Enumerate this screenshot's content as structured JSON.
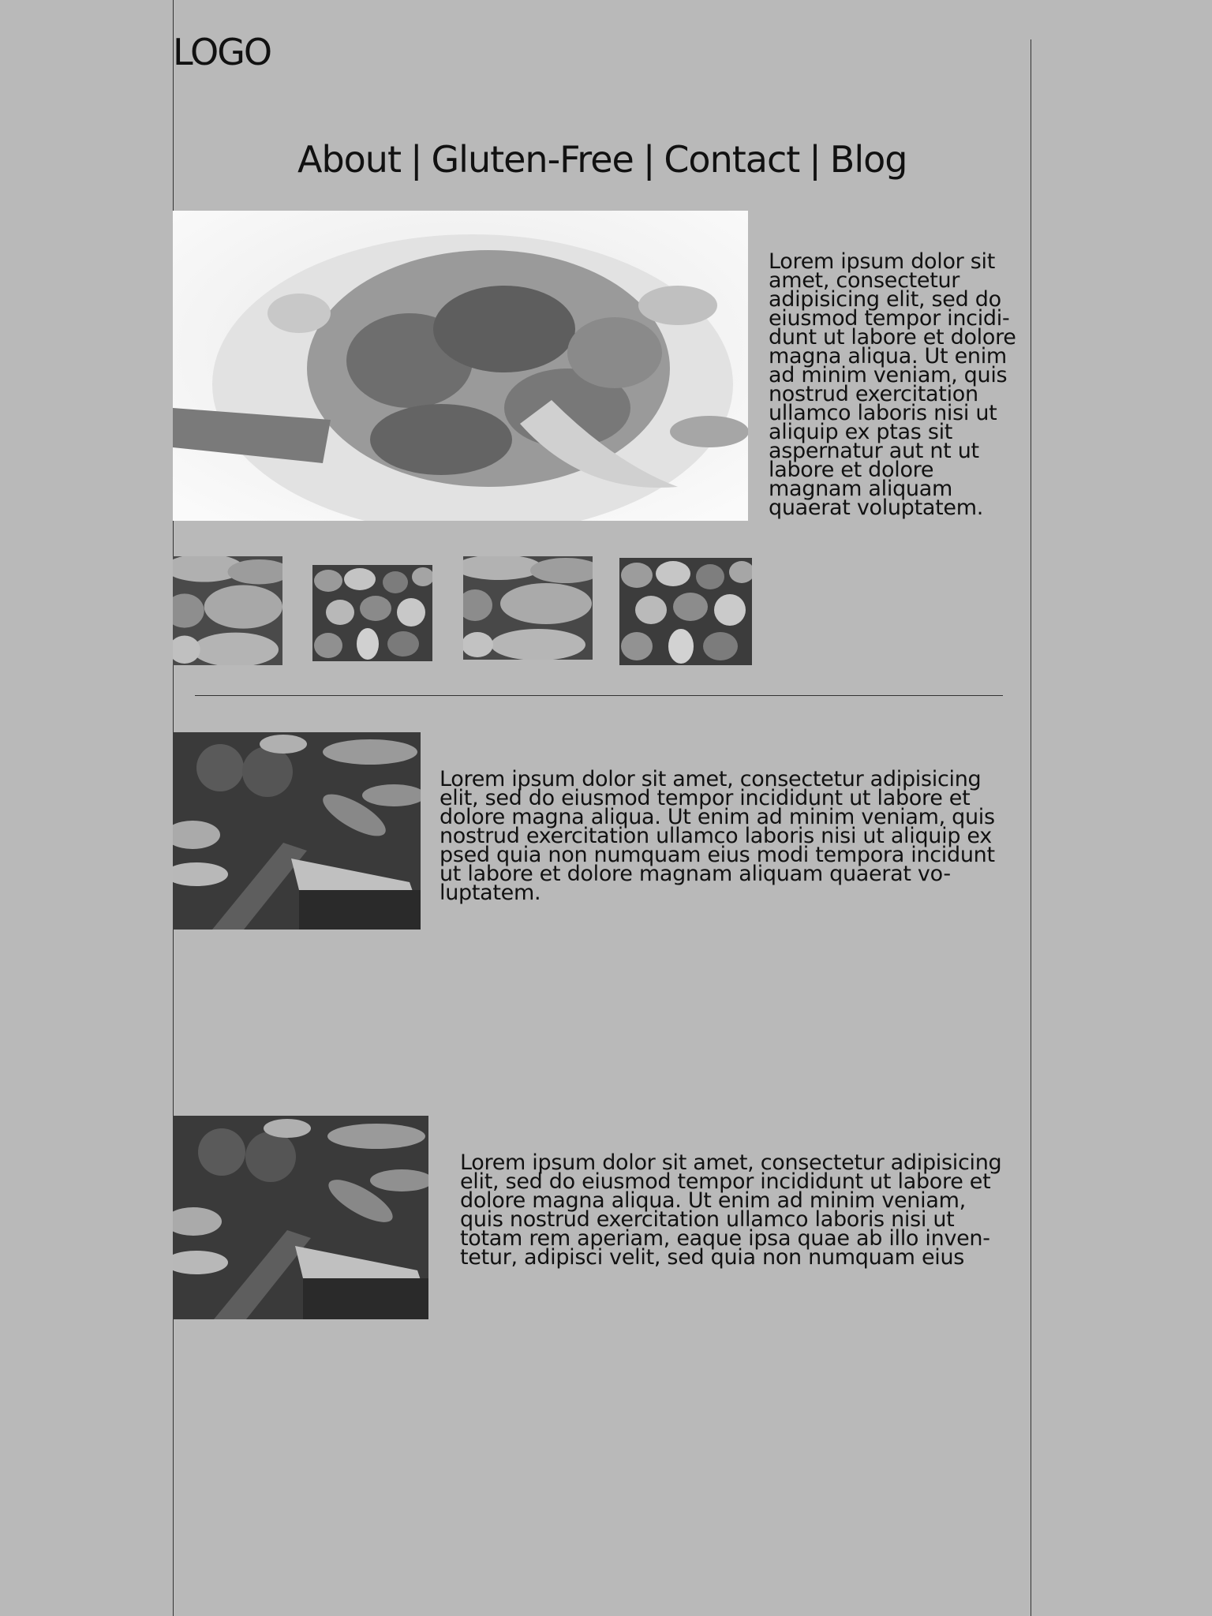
{
  "header": {
    "logo": "LOGO"
  },
  "nav": {
    "items": [
      "About",
      "Gluten-Free",
      "Contact",
      "Blog"
    ],
    "separator": "|"
  },
  "hero": {
    "image_icon": "food-dish-image",
    "text": "Lorem ipsum dolor sit amet, consectetur adipisicing elit, sed do eiusmod tempor incidi-dunt ut labore et dolore magna aliqua. Ut enim ad minim veniam, quis nostrud exercitation ullamco laboris nisi ut aliquip ex ptas sit aspernatur aut nt ut labore et dolore magnam aliquam quaerat voluptatem."
  },
  "thumbnails": [
    "bread-image",
    "nuts-image",
    "bread-image",
    "nuts-image"
  ],
  "rows": [
    {
      "image_icon": "vegetables-image",
      "text": "Lorem ipsum dolor sit amet, consectetur adipisicing elit, sed do eiusmod tempor incididunt ut labore et dolore magna aliqua. Ut enim ad minim veniam, quis nostrud exercitation ullamco laboris nisi ut aliquip ex psed quia non numquam eius modi tempora incidunt ut labore et dolore magnam aliquam quaerat vo-luptatem."
    },
    {
      "image_icon": "vegetables-image",
      "text": "Lorem ipsum dolor sit amet, consectetur adipisicing elit, sed do eiusmod tempor incididunt ut labore et dolore magna aliqua. Ut enim ad minim veniam, quis nostrud exercitation ullamco laboris nisi ut totam rem aperiam, eaque ipsa quae ab illo inven-tetur, adipisci velit, sed quia non numquam eius"
    }
  ],
  "colors": {
    "background": "#b9b9b9",
    "text": "#111111",
    "rule": "#333333"
  }
}
